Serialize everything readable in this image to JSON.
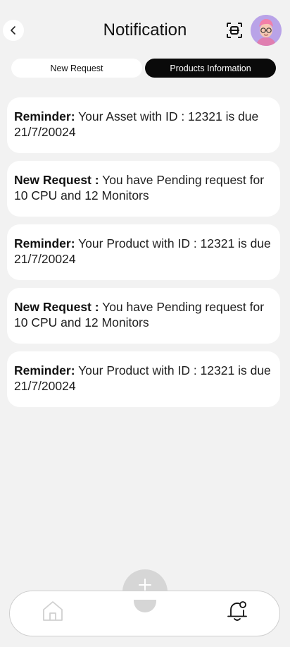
{
  "header": {
    "title": "Notification",
    "back_icon": "chevron-left-icon",
    "scan_icon": "scan-icon",
    "avatar_icon": "user-avatar"
  },
  "tabs": [
    {
      "label": "New Request",
      "active": false
    },
    {
      "label": "Products Information",
      "active": true
    }
  ],
  "notifications": [
    {
      "tag": "Reminder:",
      "text": " Your Asset with ID : 12321 is due 21/7/20024"
    },
    {
      "tag": "New Request :",
      "text": " You have Pending request for 10 CPU and 12 Monitors"
    },
    {
      "tag": "Reminder:",
      "text": " Your Product with ID : 12321 is due 21/7/20024"
    },
    {
      "tag": "New Request :",
      "text": " You have Pending request for 10 CPU and 12 Monitors"
    },
    {
      "tag": "Reminder:",
      "text": " Your Product with ID : 12321 is due 21/7/20024"
    }
  ],
  "bottom_nav": {
    "fab_icon": "plus-icon",
    "home_icon": "home-icon",
    "bell_icon": "bell-icon"
  },
  "colors": {
    "background": "#f2f2f2",
    "card": "#ffffff",
    "active_tab": "#0a0a0a",
    "fab": "#d6d6d6"
  }
}
